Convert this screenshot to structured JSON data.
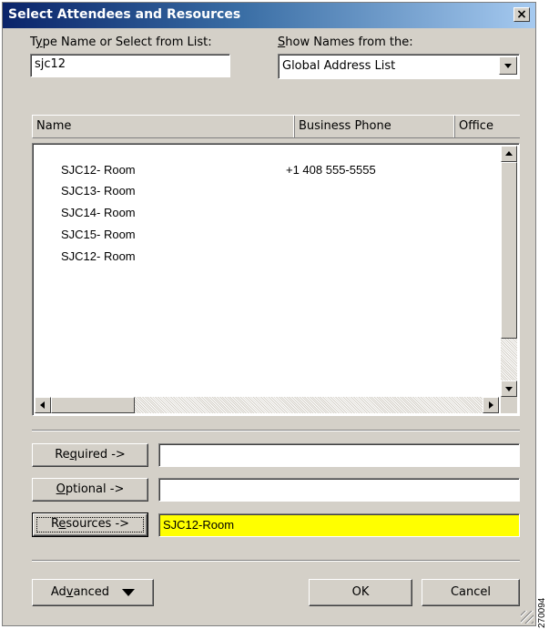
{
  "window": {
    "title": "Select Attendees and Resources",
    "close_label": "×"
  },
  "type_name": {
    "label_pre": "T",
    "label_key": "y",
    "label_post": "pe Name or Select from List:",
    "value": "sjc12"
  },
  "show_names": {
    "label_key": "S",
    "label_post": "how Names from the:",
    "selected": "Global Address List"
  },
  "list": {
    "columns": [
      "Name",
      "Business Phone",
      "Office"
    ],
    "rows": [
      {
        "name": "SJC12- Room",
        "phone": "+1 408 555-5555"
      },
      {
        "name": "SJC13- Room",
        "phone": ""
      },
      {
        "name": "SJC14- Room",
        "phone": ""
      },
      {
        "name": "SJC15- Room",
        "phone": ""
      },
      {
        "name": "SJC12- Room",
        "phone": ""
      }
    ]
  },
  "recipients": {
    "required": {
      "pre": "Re",
      "key": "q",
      "post": "uired ->",
      "value": ""
    },
    "optional": {
      "pre": "",
      "key": "O",
      "post": "ptional ->",
      "value": ""
    },
    "resources": {
      "pre": "R",
      "key": "e",
      "post": "sources ->",
      "value": "SJC12-Room",
      "highlight": "#ffff00"
    }
  },
  "footer": {
    "advanced": {
      "pre": "Ad",
      "key": "v",
      "post": "anced"
    },
    "ok": "OK",
    "cancel": "Cancel"
  },
  "side_code": "270094",
  "colors": {
    "title_start": "#0a246a",
    "title_end": "#a6caf0",
    "face": "#d4d0c8",
    "highlight": "#ffff00"
  }
}
